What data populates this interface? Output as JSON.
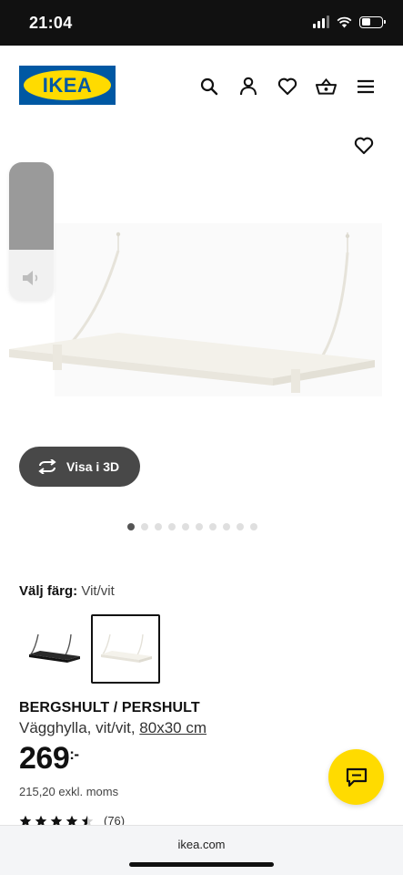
{
  "status_bar": {
    "time": "21:04",
    "battery_level": 0.45
  },
  "header": {
    "logo_text": "IKEA",
    "icons": [
      "search-icon",
      "account-icon",
      "heart-icon",
      "basket-icon",
      "menu-icon"
    ]
  },
  "gallery": {
    "visa_3d_label": "Visa i 3D",
    "image_count": 10,
    "active_image": 1
  },
  "color": {
    "label": "Välj färg:",
    "value": "Vit/vit"
  },
  "product": {
    "name": "BERGSHULT / PERSHULT",
    "description": "Vägghylla, vit/vit,",
    "size": "80x30 cm",
    "price": "269",
    "price_suffix": ":-",
    "price_excl": "215,20 exkl. moms",
    "rating_count": "(76)",
    "rating": 4.5
  },
  "browser": {
    "url": "ikea.com"
  },
  "colors": {
    "ikea_blue": "#0058a3",
    "ikea_yellow": "#ffdb00"
  }
}
